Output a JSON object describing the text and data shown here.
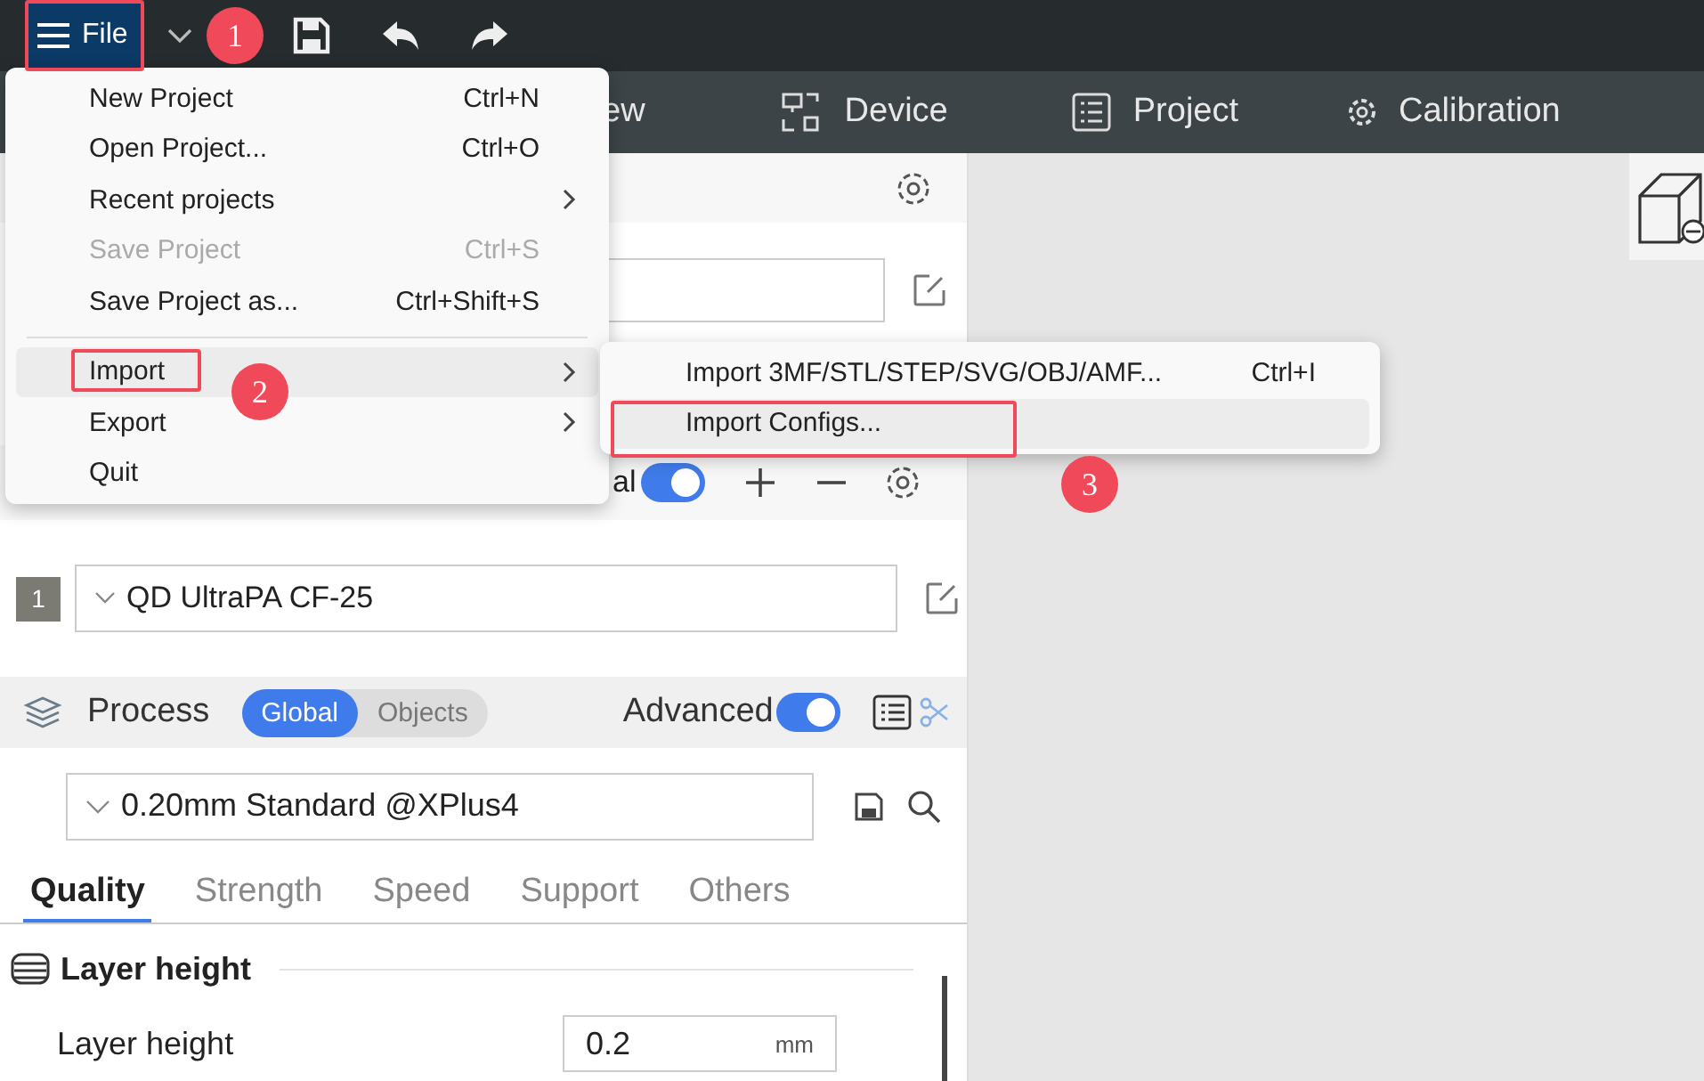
{
  "toolbar": {
    "file_button": {
      "label": "File",
      "selected": true
    }
  },
  "nav_tabs": [
    {
      "label": "ew",
      "kind": "plain"
    },
    {
      "label": "Device",
      "kind": "device"
    },
    {
      "label": "Project",
      "kind": "project"
    },
    {
      "label": "Calibration",
      "kind": "calibration"
    }
  ],
  "file_menu": {
    "items": [
      {
        "kind": "item",
        "label": "New Project",
        "shortcut": "Ctrl+N",
        "submenu": false,
        "disabled": false,
        "highlighted": false
      },
      {
        "kind": "item",
        "label": "Open Project...",
        "shortcut": "Ctrl+O",
        "submenu": false,
        "disabled": false,
        "highlighted": false
      },
      {
        "kind": "item",
        "label": "Recent projects",
        "submenu": true,
        "disabled": false,
        "highlighted": false
      },
      {
        "kind": "item",
        "label": "Save Project",
        "shortcut": "Ctrl+S",
        "submenu": false,
        "disabled": true,
        "highlighted": false
      },
      {
        "kind": "item",
        "label": "Save Project as...",
        "shortcut": "Ctrl+Shift+S",
        "submenu": false,
        "disabled": false,
        "highlighted": false
      },
      {
        "kind": "separator"
      },
      {
        "kind": "item",
        "label": "Import",
        "submenu": true,
        "disabled": false,
        "highlighted": true
      },
      {
        "kind": "item",
        "label": "Export",
        "submenu": true,
        "disabled": false,
        "highlighted": false
      },
      {
        "kind": "item",
        "label": "Quit",
        "submenu": false,
        "disabled": false,
        "highlighted": false
      }
    ]
  },
  "import_submenu": {
    "items": [
      {
        "label": "Import 3MF/STL/STEP/SVG/OBJ/AMF...",
        "shortcut": "Ctrl+I",
        "highlighted": false
      },
      {
        "label": "Import Configs...",
        "highlighted": true
      }
    ]
  },
  "filament": {
    "label_fragment": "al",
    "multi_on": true,
    "rows": [
      {
        "index": "1",
        "name": "QD UltraPA CF-25"
      }
    ]
  },
  "process": {
    "title": "Process",
    "scope_tabs": [
      {
        "label": "Global",
        "selected": true
      },
      {
        "label": "Objects",
        "selected": false
      }
    ],
    "advanced_label": "Advanced",
    "advanced_on": true,
    "preset": "0.20mm Standard @XPlus4",
    "tabs": [
      {
        "label": "Quality",
        "selected": true
      },
      {
        "label": "Strength",
        "selected": false
      },
      {
        "label": "Speed",
        "selected": false
      },
      {
        "label": "Support",
        "selected": false
      },
      {
        "label": "Others",
        "selected": false
      }
    ],
    "section": "Layer height",
    "fields": [
      {
        "label": "Layer height",
        "value": "0.2",
        "unit": "mm"
      }
    ]
  },
  "annotations": [
    {
      "number": "1"
    },
    {
      "number": "2"
    },
    {
      "number": "3"
    }
  ]
}
